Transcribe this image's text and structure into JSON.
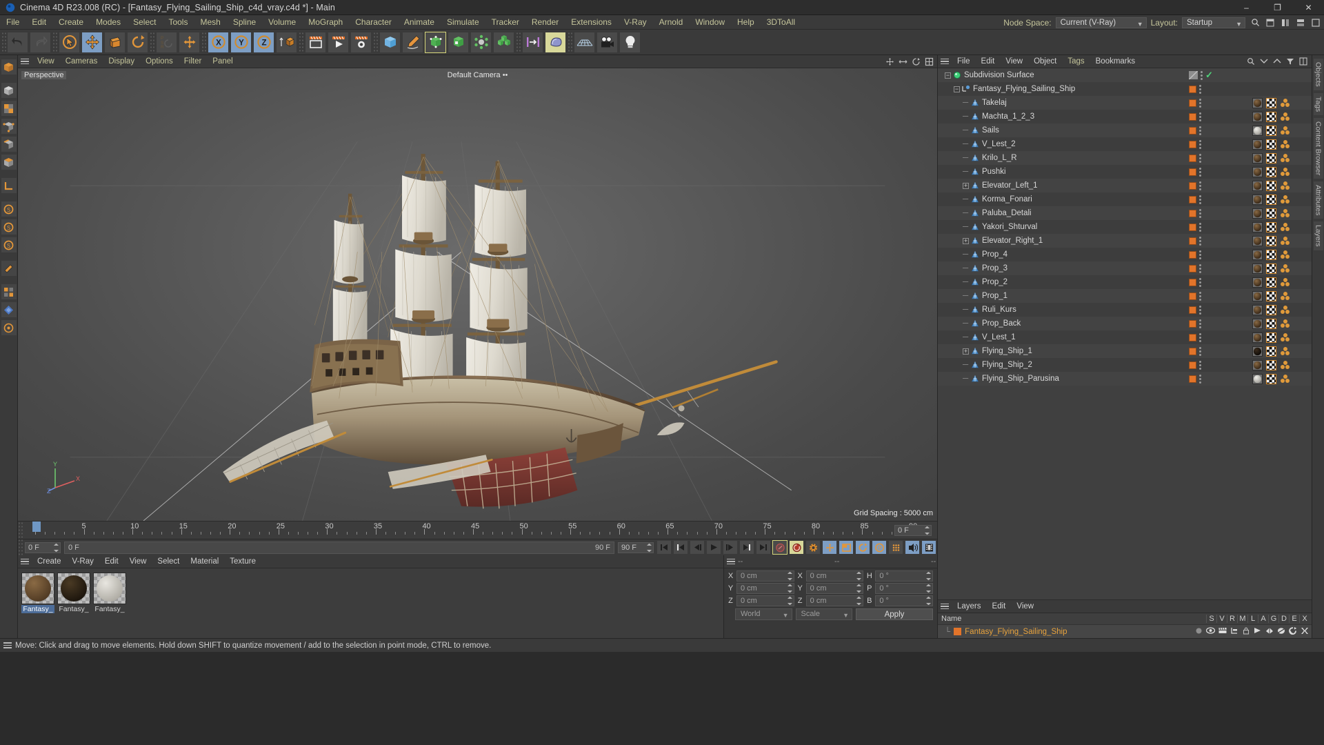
{
  "window": {
    "title": "Cinema 4D R23.008 (RC) - [Fantasy_Flying_Sailing_Ship_c4d_vray.c4d *] - Main",
    "minimize": "–",
    "maximize": "❐",
    "close": "✕"
  },
  "menubar": {
    "items": [
      "File",
      "Edit",
      "Create",
      "Modes",
      "Select",
      "Tools",
      "Mesh",
      "Spline",
      "Volume",
      "MoGraph",
      "Character",
      "Animate",
      "Simulate",
      "Tracker",
      "Render",
      "Extensions",
      "V-Ray",
      "Arnold",
      "Window",
      "Help",
      "3DToAll"
    ],
    "node_space_label": "Node Space:",
    "node_space_value": "Current (V-Ray)",
    "layout_label": "Layout:",
    "layout_value": "Startup"
  },
  "viewport": {
    "menu": [
      "View",
      "Cameras",
      "Display",
      "Options",
      "Filter",
      "Panel"
    ],
    "projection_label": "Perspective",
    "camera_label": "Default Camera",
    "grid_label": "Grid Spacing : 5000 cm",
    "axis_x": "X",
    "axis_y": "Y",
    "axis_z": "Z"
  },
  "timeline": {
    "ticks": [
      "0",
      "5",
      "10",
      "15",
      "20",
      "25",
      "30",
      "35",
      "40",
      "45",
      "50",
      "55",
      "60",
      "65",
      "70",
      "75",
      "80",
      "85",
      "90"
    ],
    "current_frame_right": "0 F",
    "current_frame": "0 F",
    "preview_min": "0 F",
    "range_end": "90 F",
    "range_field": "90 F"
  },
  "material_manager": {
    "menu": [
      "Create",
      "V-Ray",
      "Edit",
      "View",
      "Select",
      "Material",
      "Texture"
    ],
    "materials": [
      {
        "name": "Fantasy_",
        "selected": true,
        "c1": "#8a6a44",
        "c2": "#4a3520"
      },
      {
        "name": "Fantasy_",
        "selected": false,
        "c1": "#4a3a24",
        "c2": "#17110a"
      },
      {
        "name": "Fantasy_",
        "selected": false,
        "c1": "#e8e6e0",
        "c2": "#a9a69e"
      }
    ]
  },
  "coordinates": {
    "header_dashes": [
      "--",
      "--",
      "--"
    ],
    "rows": [
      {
        "l1": "X",
        "v1": "0 cm",
        "l2": "X",
        "v2": "0 cm",
        "l3": "H",
        "v3": "0 °"
      },
      {
        "l1": "Y",
        "v1": "0 cm",
        "l2": "Y",
        "v2": "0 cm",
        "l3": "P",
        "v3": "0 °"
      },
      {
        "l1": "Z",
        "v1": "0 cm",
        "l2": "Z",
        "v2": "0 cm",
        "l3": "B",
        "v3": "0 °"
      }
    ],
    "space_select": "World",
    "mode_select": "Scale",
    "apply_label": "Apply"
  },
  "object_manager": {
    "menu": [
      "File",
      "Edit",
      "View",
      "Object",
      "Tags",
      "Bookmarks"
    ],
    "items": [
      {
        "label": "Subdivision Surface",
        "depth": 0,
        "type": "generator",
        "expander": "minus",
        "swatch": false,
        "tags": "subd"
      },
      {
        "label": "Fantasy_Flying_Sailing_Ship",
        "depth": 1,
        "type": "null",
        "expander": "minus",
        "swatch": true,
        "tags": "none"
      },
      {
        "label": "Takelaj",
        "depth": 2,
        "type": "poly",
        "expander": "none",
        "swatch": true,
        "tags": "wood"
      },
      {
        "label": "Machta_1_2_3",
        "depth": 2,
        "type": "poly",
        "expander": "none",
        "swatch": true,
        "tags": "wood"
      },
      {
        "label": "Sails",
        "depth": 2,
        "type": "poly",
        "expander": "none",
        "swatch": true,
        "tags": "white"
      },
      {
        "label": "V_Lest_2",
        "depth": 2,
        "type": "poly",
        "expander": "none",
        "swatch": true,
        "tags": "wood"
      },
      {
        "label": "Krilo_L_R",
        "depth": 2,
        "type": "poly",
        "expander": "none",
        "swatch": true,
        "tags": "wood"
      },
      {
        "label": "Pushki",
        "depth": 2,
        "type": "poly",
        "expander": "none",
        "swatch": true,
        "tags": "wood"
      },
      {
        "label": "Elevator_Left_1",
        "depth": 2,
        "type": "poly",
        "expander": "plus",
        "swatch": true,
        "tags": "wood"
      },
      {
        "label": "Korma_Fonari",
        "depth": 2,
        "type": "poly",
        "expander": "none",
        "swatch": true,
        "tags": "wood"
      },
      {
        "label": "Paluba_Detali",
        "depth": 2,
        "type": "poly",
        "expander": "none",
        "swatch": true,
        "tags": "wood"
      },
      {
        "label": "Yakori_Shturval",
        "depth": 2,
        "type": "poly",
        "expander": "none",
        "swatch": true,
        "tags": "wood"
      },
      {
        "label": "Elevator_Right_1",
        "depth": 2,
        "type": "poly",
        "expander": "plus",
        "swatch": true,
        "tags": "wood"
      },
      {
        "label": "Prop_4",
        "depth": 2,
        "type": "poly",
        "expander": "none",
        "swatch": true,
        "tags": "wood"
      },
      {
        "label": "Prop_3",
        "depth": 2,
        "type": "poly",
        "expander": "none",
        "swatch": true,
        "tags": "wood"
      },
      {
        "label": "Prop_2",
        "depth": 2,
        "type": "poly",
        "expander": "none",
        "swatch": true,
        "tags": "wood"
      },
      {
        "label": "Prop_1",
        "depth": 2,
        "type": "poly",
        "expander": "none",
        "swatch": true,
        "tags": "wood"
      },
      {
        "label": "Ruli_Kurs",
        "depth": 2,
        "type": "poly",
        "expander": "none",
        "swatch": true,
        "tags": "wood"
      },
      {
        "label": "Prop_Back",
        "depth": 2,
        "type": "poly",
        "expander": "none",
        "swatch": true,
        "tags": "wood"
      },
      {
        "label": "V_Lest_1",
        "depth": 2,
        "type": "poly",
        "expander": "none",
        "swatch": true,
        "tags": "wood"
      },
      {
        "label": "Flying_Ship_1",
        "depth": 2,
        "type": "poly",
        "expander": "plus",
        "swatch": true,
        "tags": "dark"
      },
      {
        "label": "Flying_Ship_2",
        "depth": 2,
        "type": "poly",
        "expander": "none",
        "swatch": true,
        "tags": "wood"
      },
      {
        "label": "Flying_Ship_Parusina",
        "depth": 2,
        "type": "poly",
        "expander": "none",
        "swatch": true,
        "tags": "white"
      }
    ]
  },
  "layers_panel": {
    "menu": [
      "Layers",
      "Edit",
      "View"
    ],
    "name_col": "Name",
    "columns": [
      "S",
      "V",
      "R",
      "M",
      "L",
      "A",
      "G",
      "D",
      "E",
      "X"
    ],
    "rows": [
      {
        "name": "Fantasy_Flying_Sailing_Ship",
        "color": "#e2742a"
      }
    ]
  },
  "right_tabs": [
    "Objects",
    "Tags",
    "Content Browser",
    "Attributes",
    "Layers"
  ],
  "statusbar": {
    "message": "Move: Click and drag to move elements. Hold down SHIFT to quantize movement / add to the selection in point mode, CTRL to remove."
  },
  "colors": {
    "accent_orange": "#e2742a",
    "menu_text": "#c5c59b",
    "panel_bg": "#3a3a3a",
    "tool_active_blue": "#7d9ec4",
    "tool_active_yellow": "#d8d89a"
  }
}
